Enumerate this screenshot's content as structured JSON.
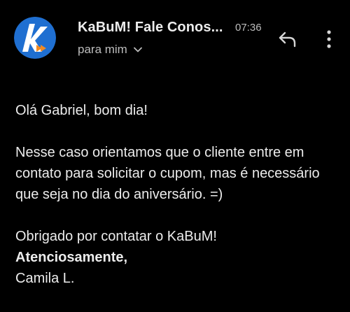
{
  "header": {
    "sender": "KaBuM! Fale Conos...",
    "time": "07:36",
    "recipient": "para mim",
    "avatar_icon": "kabum-logo-icon",
    "reply_icon": "reply-icon",
    "more_icon": "more-vert-icon"
  },
  "message": {
    "greeting": "Olá Gabriel, bom dia!",
    "paragraph": "Nesse caso orientamos que o cliente entre em contato para solicitar o cupom, mas é necessário que seja no dia do aniversário. =)",
    "thanks": "Obrigado por contatar o KaBuM!",
    "closing": "Atenciosamente,",
    "signature": "Camila L."
  },
  "colors": {
    "background": "#000000",
    "text": "#ececec",
    "muted": "#bdbdbd",
    "avatar_blue": "#1f6fd1",
    "avatar_orange": "#f08a24"
  }
}
